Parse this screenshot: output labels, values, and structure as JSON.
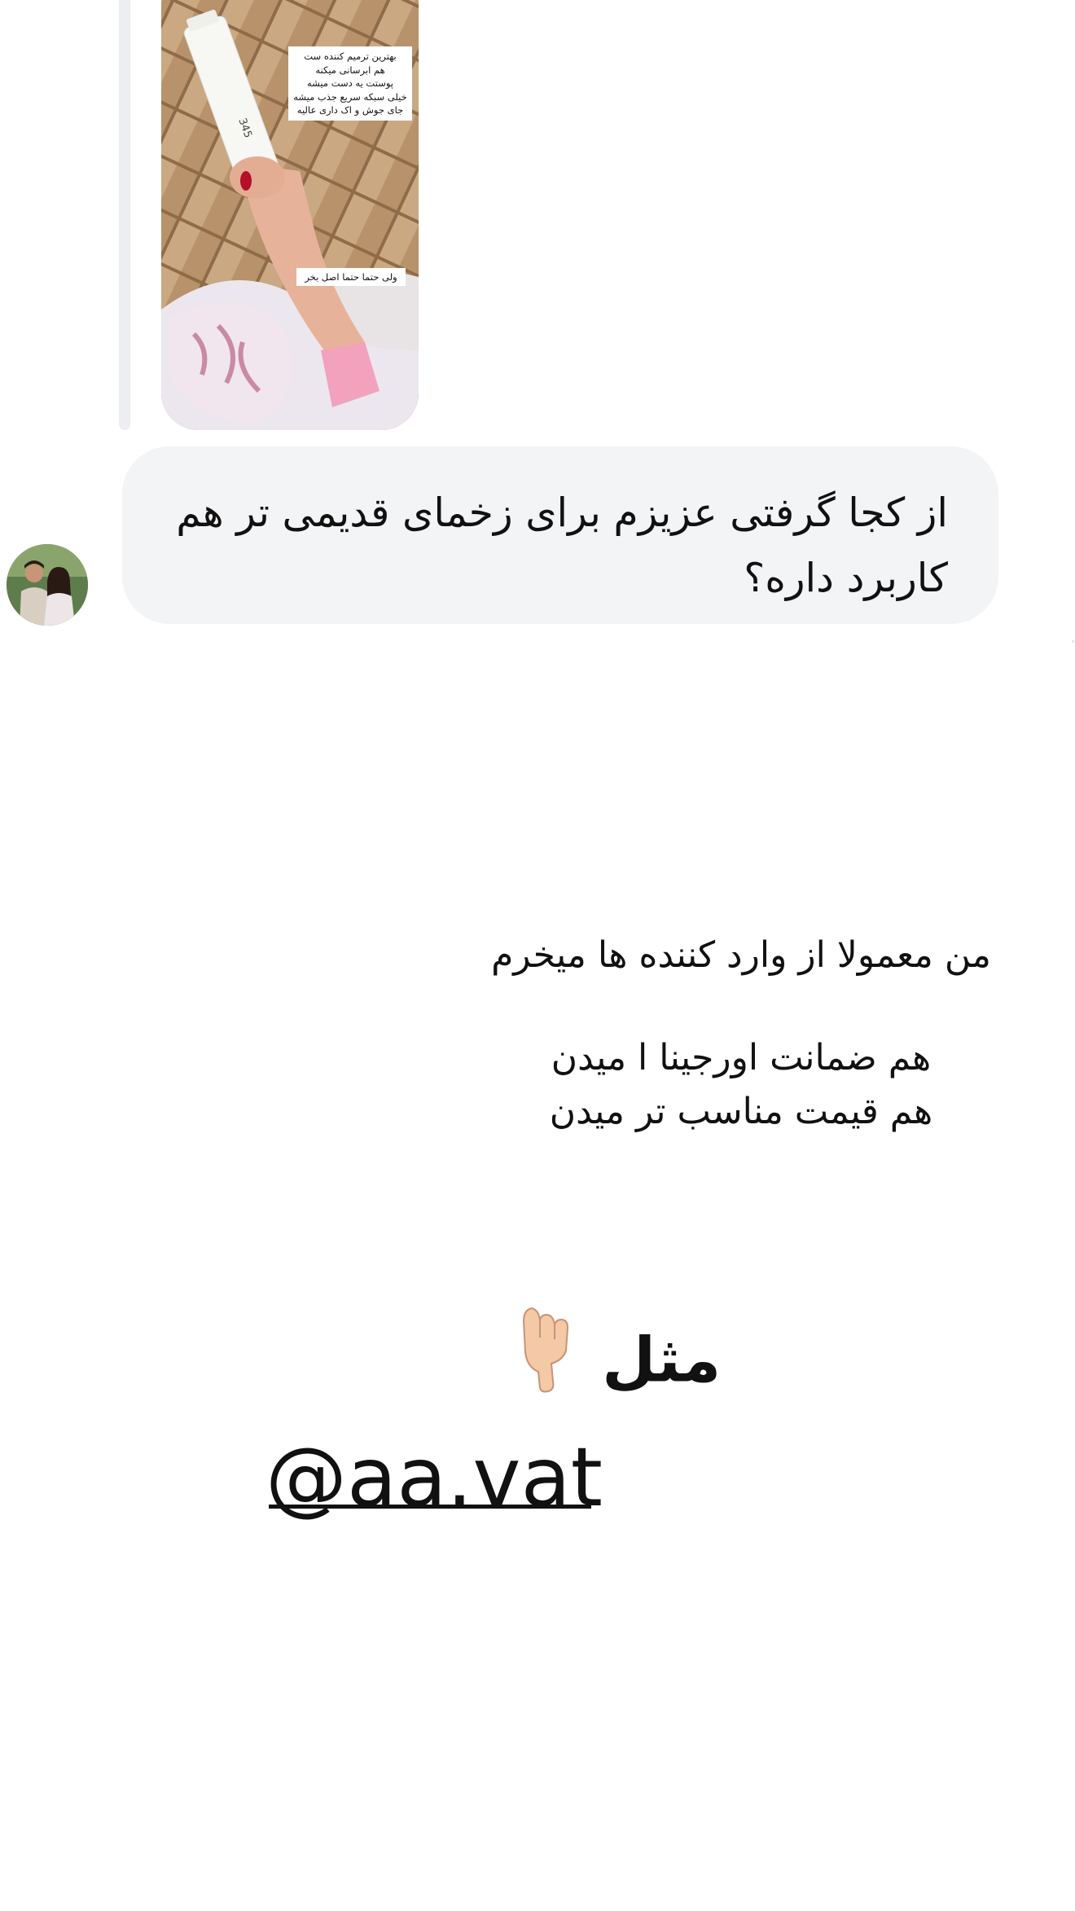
{
  "story_reply": {
    "sticker_top_lines": [
      "بهترین ترمیم کننده ست",
      "هم ابرسانی میکنه",
      "پوستت یه دست میشه",
      "خیلی سبکه سریع جذب میشه",
      "جای جوش و اک داری عالیه"
    ],
    "sticker_bottom": "ولی حتما حتما اصل بخر",
    "product_code": "345"
  },
  "message": {
    "line1": "از کجا گرفتی عزیزم برای زخمای قدیمی تر هم",
    "line2": "کاربرد داره؟"
  },
  "story": {
    "line1": "من معمولا از وارد کننده ها میخرم",
    "line2": "هم ضمانت اورجینا ا میدن",
    "line3": "هم قیمت مناسب تر میدن",
    "example": "مثل",
    "hand_icon": "backhand-index-pointing-down",
    "mention_symbol": "@",
    "mention_handle": "aa.vat"
  },
  "colors": {
    "bubble": "#f3f4f6",
    "reply_bar": "#eceef1",
    "text": "#111111"
  }
}
